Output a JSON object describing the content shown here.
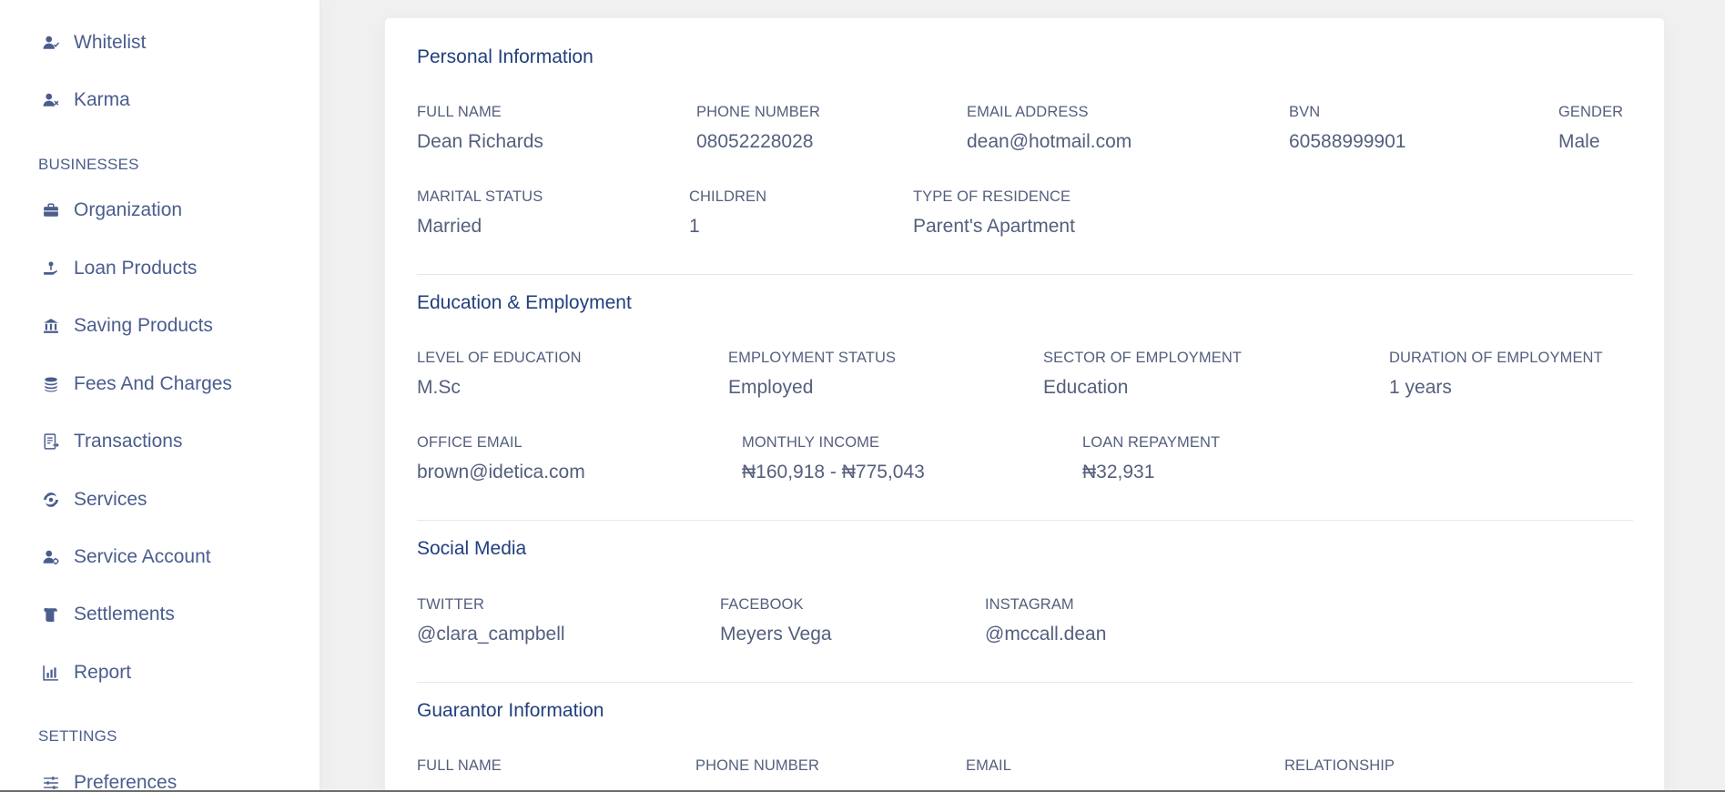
{
  "sidebar": {
    "items_top": [
      {
        "label": "Whitelist",
        "icon": "user-check-icon"
      },
      {
        "label": "Karma",
        "icon": "user-x-icon"
      }
    ],
    "section_businesses": "BUSINESSES",
    "businesses": [
      {
        "label": "Organization",
        "icon": "briefcase-icon"
      },
      {
        "label": "Loan Products",
        "icon": "loan-request-icon"
      },
      {
        "label": "Saving Products",
        "icon": "bank-icon"
      },
      {
        "label": "Fees And Charges",
        "icon": "coins-icon"
      },
      {
        "label": "Transactions",
        "icon": "transactions-icon"
      },
      {
        "label": "Services",
        "icon": "galaxy-icon"
      },
      {
        "label": "Service Account",
        "icon": "user-cog-icon"
      },
      {
        "label": "Settlements",
        "icon": "scroll-icon"
      },
      {
        "label": "Report",
        "icon": "chart-bar-icon"
      }
    ],
    "section_settings": "SETTINGS",
    "settings": [
      {
        "label": "Preferences",
        "icon": "sliders-icon"
      }
    ]
  },
  "personal": {
    "title": "Personal Information",
    "row1": [
      {
        "label": "Full Name",
        "value": "Dean Richards"
      },
      {
        "label": "Phone Number",
        "value": "08052228028"
      },
      {
        "label": "Email Address",
        "value": "dean@hotmail.com"
      },
      {
        "label": "BVN",
        "value": "60588999901"
      },
      {
        "label": "Gender",
        "value": "Male"
      }
    ],
    "row2": [
      {
        "label": "Marital Status",
        "value": "Married"
      },
      {
        "label": "Children",
        "value": "1"
      },
      {
        "label": "Type of Residence",
        "value": "Parent's Apartment"
      }
    ]
  },
  "education": {
    "title": "Education & Employment",
    "row1": [
      {
        "label": "Level of Education",
        "value": "M.Sc"
      },
      {
        "label": "Employment Status",
        "value": "Employed"
      },
      {
        "label": "Sector of Employment",
        "value": "Education"
      },
      {
        "label": "Duration of Employment",
        "value": "1 years"
      }
    ],
    "row2": [
      {
        "label": "Office Email",
        "value": "brown@idetica.com"
      },
      {
        "label": "Monthly Income",
        "value": "₦160,918 - ₦775,043"
      },
      {
        "label": "Loan Repayment",
        "value": "₦32,931"
      }
    ]
  },
  "social": {
    "title": "Social Media",
    "row1": [
      {
        "label": "Twitter",
        "value": "@clara_campbell"
      },
      {
        "label": "Facebook",
        "value": "Meyers Vega"
      },
      {
        "label": "Instagram",
        "value": "@mccall.dean"
      }
    ]
  },
  "guarantor": {
    "title": "Guarantor Information",
    "row1": [
      {
        "label": "Full Name",
        "value": ""
      },
      {
        "label": "Phone Number",
        "value": ""
      },
      {
        "label": "Email",
        "value": ""
      },
      {
        "label": "Relationship",
        "value": ""
      }
    ]
  },
  "colors": {
    "sidebar_text": "#4a5d8d",
    "heading": "#213f7d",
    "field_text": "#545f7d",
    "background": "#f0f0f0"
  }
}
